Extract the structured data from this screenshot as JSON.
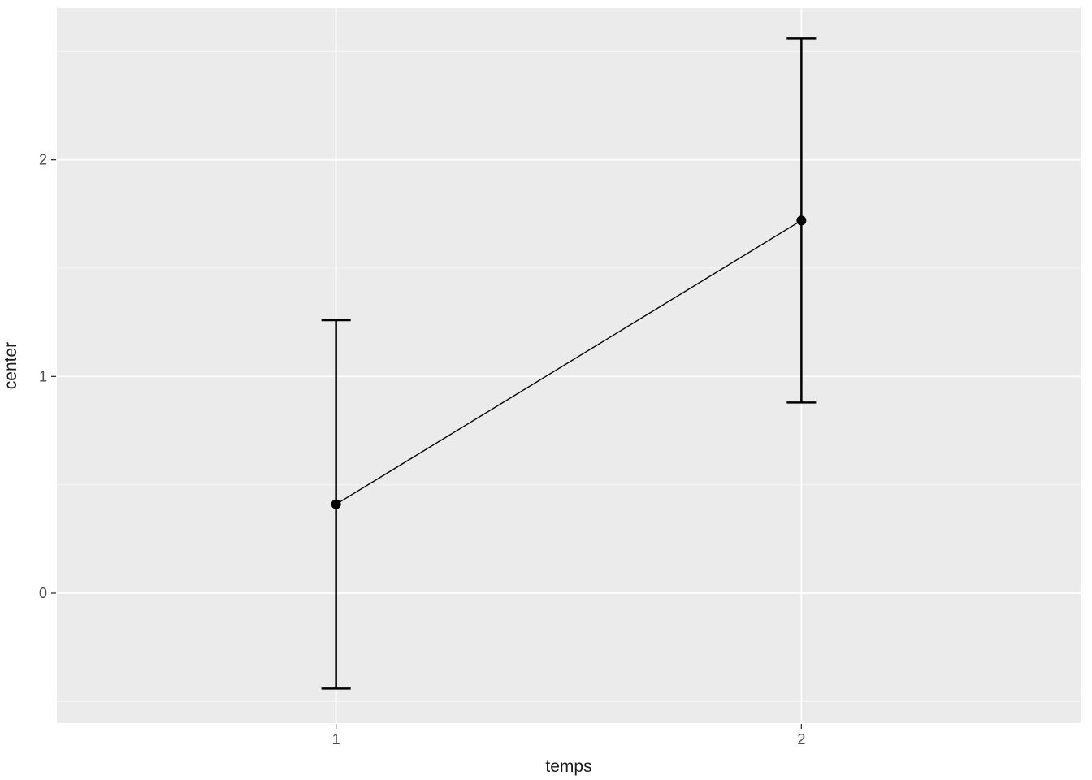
{
  "chart_data": {
    "type": "line",
    "categories": [
      "1",
      "2"
    ],
    "series": [
      {
        "name": "center",
        "values": [
          0.41,
          1.72
        ],
        "error_low": [
          -0.44,
          0.88
        ],
        "error_high": [
          1.26,
          2.56
        ]
      }
    ],
    "xlabel": "temps",
    "ylabel": "center",
    "ylim": [
      -0.6,
      2.7
    ],
    "y_ticks": [
      0,
      1,
      2
    ],
    "y_minor": [
      -0.5,
      0.5,
      1.5,
      2.5
    ],
    "grid": true,
    "title": ""
  },
  "colors": {
    "panel_bg": "#EBEBEB",
    "grid_major": "#FFFFFF",
    "grid_minor": "#FFFFFF",
    "point": "#000000",
    "line": "#000000",
    "text": "#4D4D4D"
  }
}
